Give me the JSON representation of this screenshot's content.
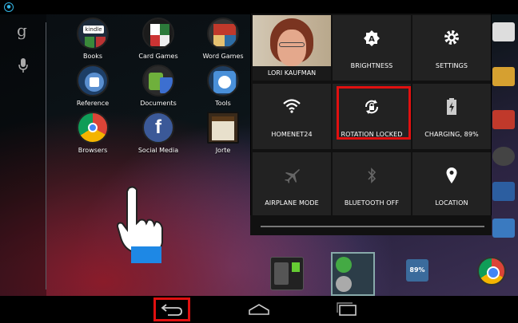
{
  "status_bar": {
    "notification_icon": "notification-icon"
  },
  "home": {
    "search_letter": "g",
    "apps": [
      {
        "label": "Books",
        "badge": "kindle"
      },
      {
        "label": "Card Games"
      },
      {
        "label": "Word Games"
      },
      {
        "label": "Reference"
      },
      {
        "label": "Documents"
      },
      {
        "label": "Tools"
      },
      {
        "label": "Browsers"
      },
      {
        "label": "Social Media"
      },
      {
        "label": "Jorte"
      }
    ],
    "dock": {
      "battery_widget": "89%"
    }
  },
  "quick_settings": {
    "user_name": "LORI KAUFMAN",
    "tiles": [
      {
        "label": "BRIGHTNESS",
        "icon": "brightness-auto-icon"
      },
      {
        "label": "SETTINGS",
        "icon": "gear-icon"
      },
      {
        "label": "HOMENET24",
        "icon": "wifi-icon"
      },
      {
        "label": "ROTATION LOCKED",
        "icon": "rotation-lock-icon"
      },
      {
        "label": "CHARGING, 89%",
        "icon": "battery-charging-icon"
      },
      {
        "label": "AIRPLANE MODE",
        "icon": "airplane-icon"
      },
      {
        "label": "BLUETOOTH OFF",
        "icon": "bluetooth-icon"
      },
      {
        "label": "LOCATION",
        "icon": "location-pin-icon"
      }
    ]
  },
  "navigation": {
    "back": "back-icon",
    "home": "home-icon",
    "recents": "recent-apps-icon"
  },
  "colors": {
    "highlight": "#e01010",
    "accent": "#33b5e5",
    "tile_bg": "#222222",
    "panel_bg": "#111111"
  }
}
